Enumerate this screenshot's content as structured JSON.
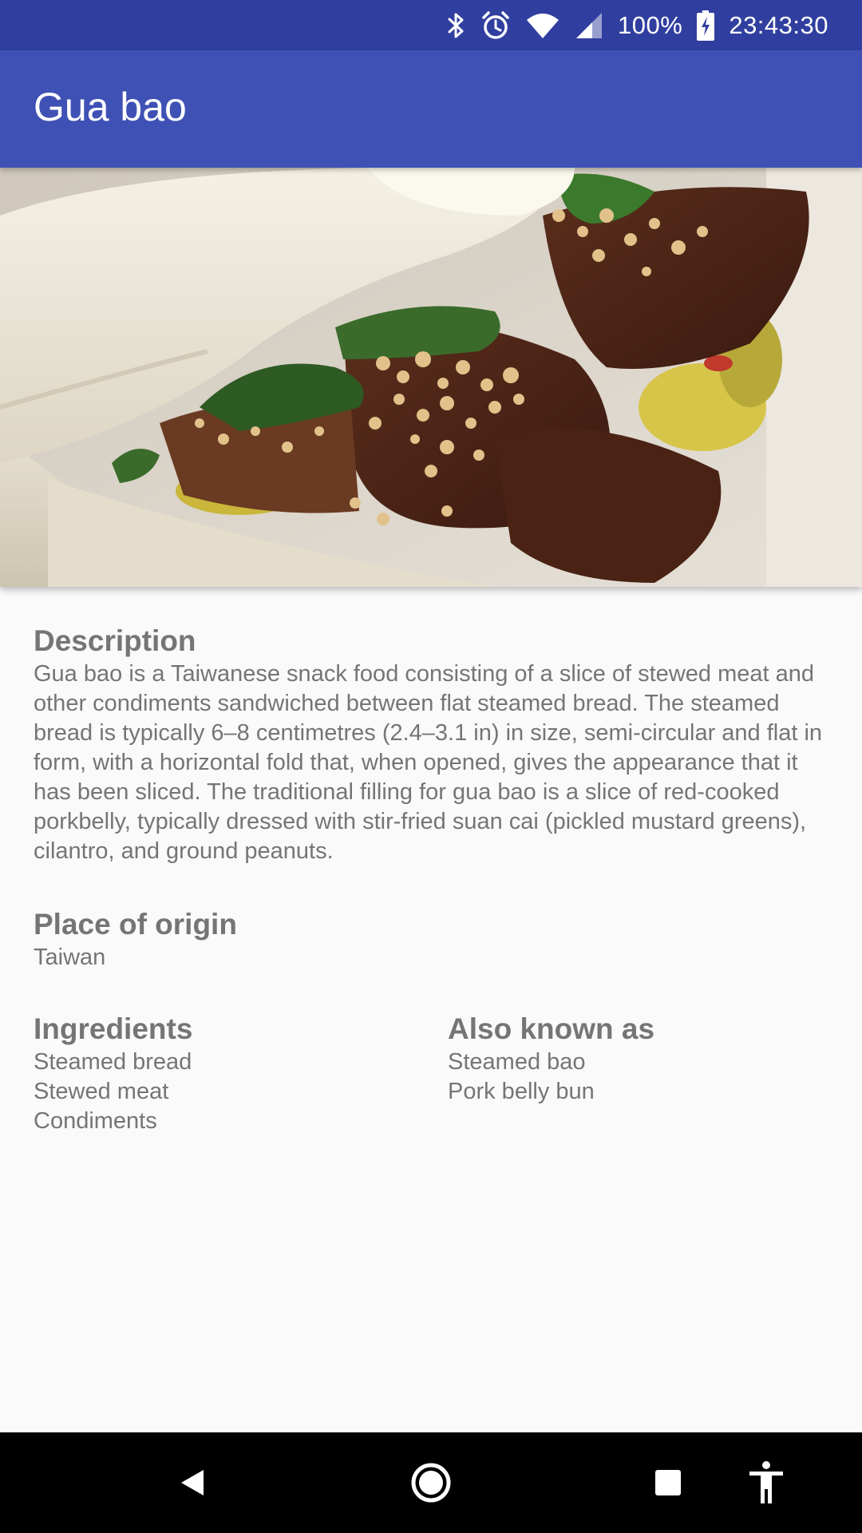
{
  "status_bar": {
    "battery": "100%",
    "time": "23:43:30",
    "icons": [
      "bluetooth-icon",
      "alarm-icon",
      "wifi-icon",
      "cell-signal-icon",
      "battery-charging-icon"
    ]
  },
  "app_bar": {
    "title": "Gua bao"
  },
  "hero": {
    "icon": "gua-bao-photo"
  },
  "description": {
    "title": "Description",
    "body": "Gua bao is a Taiwanese snack food consisting of a slice of stewed meat and other condiments sandwiched between flat steamed bread. The steamed bread is typically 6–8 centimetres (2.4–3.1 in) in size, semi-circular and flat in form, with a horizontal fold that, when opened, gives the appearance that it has been sliced. The traditional filling for gua bao is a slice of red-cooked porkbelly, typically dressed with stir-fried suan cai (pickled mustard greens), cilantro, and ground peanuts."
  },
  "origin": {
    "title": "Place of origin",
    "value": "Taiwan"
  },
  "ingredients": {
    "title": "Ingredients",
    "items": [
      "Steamed bread",
      "Stewed meat",
      "Condiments"
    ]
  },
  "aka": {
    "title": "Also known as",
    "items": [
      "Steamed bao",
      "Pork belly bun"
    ]
  },
  "nav_bar": {
    "icons": [
      "back-icon",
      "home-icon",
      "recents-icon",
      "accessibility-icon"
    ]
  },
  "colors": {
    "status_bar": "#303f9f",
    "app_bar": "#3f51b5",
    "background": "#fafafa",
    "text": "#757575"
  }
}
